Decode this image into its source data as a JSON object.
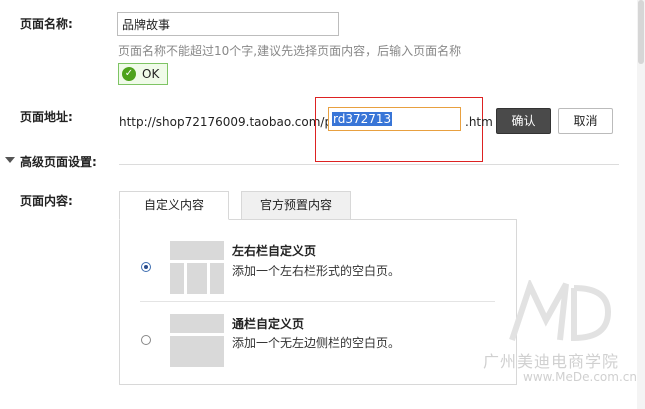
{
  "page_name": {
    "label": "页面名称:",
    "value": "品牌故事",
    "hint": "页面名称不能超过10个字,建议先选择页面内容，后输入页面名称",
    "ok_label": "OK"
  },
  "page_address": {
    "label": "页面地址:",
    "url_prefix": "http://shop72176009.taobao.com/p/",
    "value": "rd372713",
    "suffix": ".htm",
    "confirm_label": "确认",
    "cancel_label": "取消"
  },
  "advanced": {
    "label": "高级页面设置:"
  },
  "page_content": {
    "label": "页面内容:",
    "tabs": [
      {
        "label": "自定义内容",
        "active": true
      },
      {
        "label": "官方预置内容",
        "active": false
      }
    ],
    "options": [
      {
        "title": "左右栏自定义页",
        "description": "添加一个左右栏形式的空白页。",
        "selected": true
      },
      {
        "title": "通栏自定义页",
        "description": "添加一个无左边侧栏的空白页。",
        "selected": false
      }
    ]
  },
  "watermark": {
    "name": "广州美迪电商学院",
    "url": "www.MeDe.com.cn"
  },
  "colors": {
    "accent": "#3875d7",
    "highlight_box": "#dd2222",
    "ok_green": "#4ea21c",
    "confirm_button": "#4a4a4a"
  },
  "icons": {
    "ok": "check-circle-icon",
    "advanced_toggle": "triangle-down-icon"
  }
}
